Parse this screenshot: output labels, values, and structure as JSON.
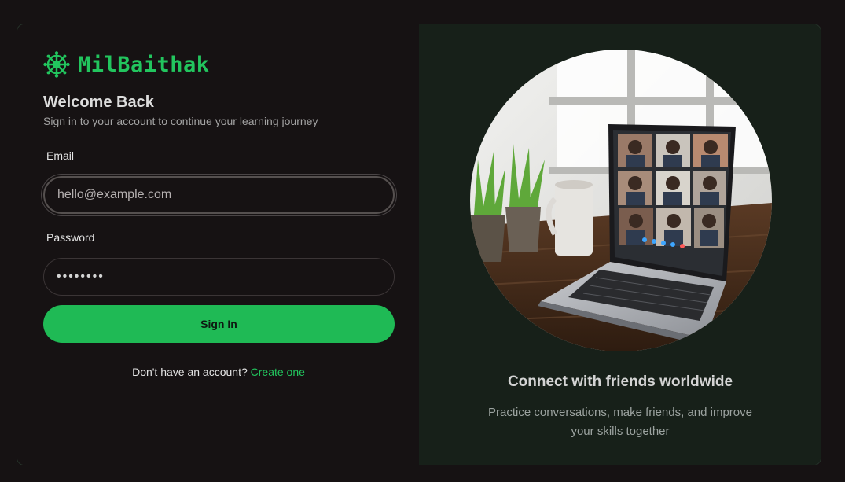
{
  "brand": {
    "name": "MilBaithak",
    "icon": "dharma-wheel-icon",
    "color": "#22c55e"
  },
  "login": {
    "title": "Welcome Back",
    "subtitle": "Sign in to your account to continue your learning journey",
    "email_label": "Email",
    "email_placeholder": "hello@example.com",
    "password_label": "Password",
    "password_value": "••••••••",
    "submit_label": "Sign In",
    "signup_prompt": "Don't have an account?",
    "signup_link": "Create one"
  },
  "promo": {
    "image": "laptop-video-call-photo",
    "title": "Connect with friends worldwide",
    "description": "Practice conversations, make friends, and improve your skills together"
  },
  "colors": {
    "background": "#161213",
    "panel": "#172019",
    "accent": "#22c55e"
  }
}
